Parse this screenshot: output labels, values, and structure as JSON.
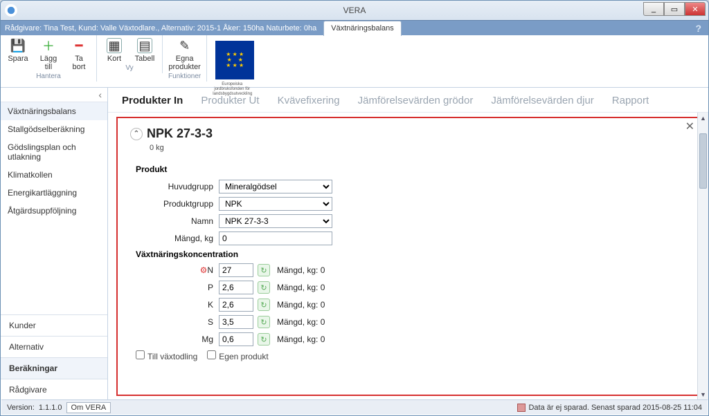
{
  "window": {
    "title": "VERA"
  },
  "crumb": {
    "text": "Rådgivare: Tina Test, Kund:    Valle  Växtodlare., Alternativ:  2015-1 Åker: 150ha Naturbete: 0ha",
    "active_tab": "Växtnäringsbalans",
    "help": "?"
  },
  "ribbon": {
    "hantera": {
      "label": "Hantera",
      "spara": "Spara",
      "lagg": "Lägg\ntill",
      "tabort": "Ta\nbort"
    },
    "vy": {
      "label": "Vy",
      "kort": "Kort",
      "tabell": "Tabell"
    },
    "funktioner": {
      "label": "Funktioner",
      "egna": "Egna\nprodukter"
    }
  },
  "sidebar": {
    "items": [
      "Växtnäringsbalans",
      "Stallgödselberäkning",
      "Gödslingsplan och utlakning",
      "Klimatkollen",
      "Energikartläggning",
      "Åtgärdsuppföljning"
    ],
    "nav": [
      "Kunder",
      "Alternativ",
      "Beräkningar",
      "Rådgivare"
    ]
  },
  "subtabs": [
    "Produkter In",
    "Produkter Ut",
    "Kvävefixering",
    "Jämförelsevärden grödor",
    "Jämförelsevärden djur",
    "Rapport"
  ],
  "panel": {
    "title": "NPK 27-3-3",
    "sub": "0 kg",
    "section_produkt": "Produkt",
    "huvudgrupp_lbl": "Huvudgrupp",
    "huvudgrupp_val": "Mineralgödsel",
    "produktgrupp_lbl": "Produktgrupp",
    "produktgrupp_val": "NPK",
    "namn_lbl": "Namn",
    "namn_val": "NPK 27-3-3",
    "mangd_lbl": "Mängd, kg",
    "mangd_val": "0",
    "conc_title": "Växtnäringskoncentration",
    "elements": [
      {
        "sym": "N",
        "val": "27",
        "mkg": "Mängd, kg: 0"
      },
      {
        "sym": "P",
        "val": "2,6",
        "mkg": "Mängd, kg: 0"
      },
      {
        "sym": "K",
        "val": "2,6",
        "mkg": "Mängd, kg: 0"
      },
      {
        "sym": "S",
        "val": "3,5",
        "mkg": "Mängd, kg: 0"
      },
      {
        "sym": "Mg",
        "val": "0,6",
        "mkg": "Mängd, kg: 0"
      }
    ],
    "chk_till": "Till växtodling",
    "chk_egen": "Egen produkt"
  },
  "status": {
    "version_lbl": "Version:",
    "version": "1.1.1.0",
    "om": "Om VERA",
    "save_msg": "Data är ej sparad. Senast sparad 2015-08-25 11:04"
  }
}
